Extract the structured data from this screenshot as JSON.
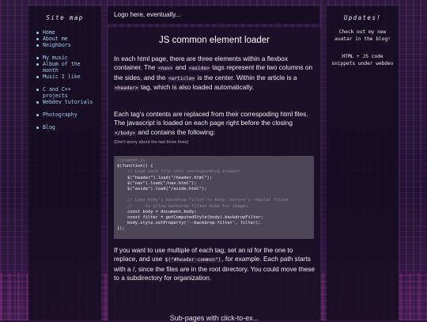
{
  "sidebar": {
    "title": "Site map",
    "groups": [
      [
        "Home",
        "About me",
        "Neighbors"
      ],
      [
        "My music",
        "Album of the month",
        "Music I like"
      ],
      [
        "C and C++ projects",
        "Webdev tutorials"
      ],
      [
        "Photography"
      ],
      [
        "Blog"
      ]
    ]
  },
  "header": {
    "text": "Logo here, eventually..."
  },
  "article": {
    "title": "JS common element loader",
    "p1_a": "In each html page, there are three elements within a flexbox container. The ",
    "p1_nav": "<nav>",
    "p1_b": " and ",
    "p1_aside": "<aside>",
    "p1_c": " tags represent the two columns on the sides, and the ",
    "p1_article": "<article>",
    "p1_d": " is the center. Within the article is a ",
    "p1_header": "<header>",
    "p1_e": " tag, which is also loaded automatically.",
    "p2_a": "Each tag's contents are replaced from their correspoding html files. The javascript is loaded on each page right before the closing ",
    "p2_body": "</body>",
    "p2_b": " and contains the following:",
    "note": "(Don't worry about the last three lines)",
    "code": [
      {
        "cls": "cm",
        "text": "//common.js"
      },
      {
        "cls": "fn",
        "text": "$(function() {"
      },
      {
        "cls": "cm",
        "text": "    // Load each file into corresponding element"
      },
      {
        "cls": "fn",
        "text": "    $(\"header\").load(\"/header.html\");"
      },
      {
        "cls": "fn",
        "text": "    $(\"nav\").load(\"/nav.html\");"
      },
      {
        "cls": "fn",
        "text": "    $(\"aside\").load(\"/aside.html\");"
      },
      {
        "cls": "fn",
        "text": " "
      },
      {
        "cls": "cm",
        "text": "    // Copy body's backdrop-filter to body::before's regular filter"
      },
      {
        "cls": "cm",
        "text": "    //     to allow backdrop-filter mode for images"
      },
      {
        "cls": "fn",
        "text": "    const body = document.body;"
      },
      {
        "cls": "fn",
        "text": "    const filter = getComputedStyle(body).backdropFilter;"
      },
      {
        "cls": "fn",
        "text": "    body.style.setProperty('--backdrop-filter', filter);"
      },
      {
        "cls": "fn",
        "text": "});"
      }
    ],
    "p3_a": "If you want to use multiple of each tag, set an id for the one to replace, and use ",
    "p3_sel": "$(\"#header-common\")",
    "p3_b": ", for example. Each path starts with a /, since the files are in the root directory. You could move these to a subdirectory for organization.",
    "footer": "Sub-pages with click-to-ex..."
  },
  "aside": {
    "title": "Updates!",
    "items": [
      "Check out my new avatar in the blog!",
      "HTML + JS code snippets under webdev"
    ]
  },
  "colors": {
    "link": "#9fd0f2",
    "panel": "#160c20",
    "background": "#2a1638"
  }
}
